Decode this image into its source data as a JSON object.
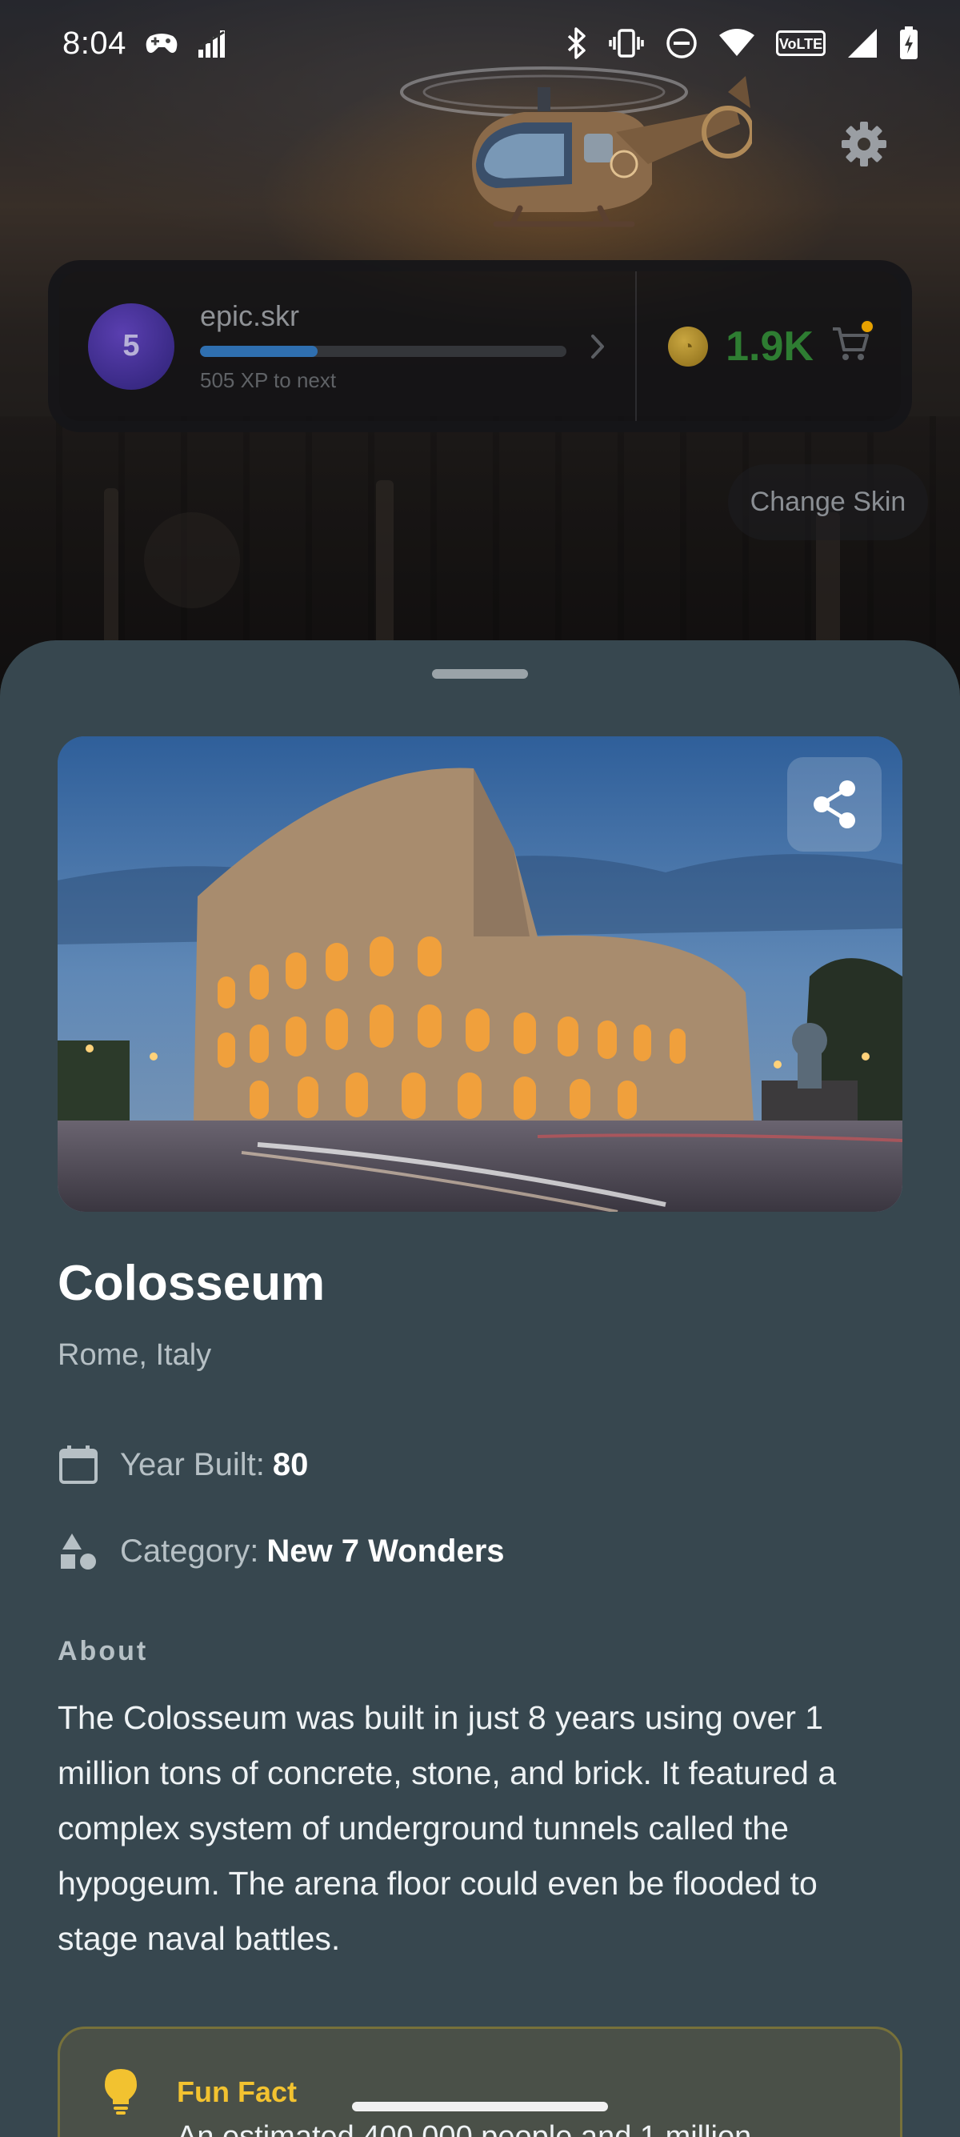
{
  "status_bar": {
    "time": "8:04"
  },
  "profile": {
    "level": "5",
    "username": "epic.skr",
    "xp_progress_percent": 32,
    "xp_to_next": "505 XP to next",
    "coins": "1.9K"
  },
  "change_skin_label": "Change Skin",
  "landmark": {
    "title": "Colosseum",
    "location": "Rome, Italy",
    "year_label": "Year Built:",
    "year_value": "80",
    "category_label": "Category:",
    "category_value": "New 7 Wonders",
    "about_heading": "About",
    "about_text": "The Colosseum was built in just 8 years using over 1 million tons of concrete, stone, and brick. It featured a complex system of underground tunnels called the hypogeum. The arena floor could even be flooded to stage naval battles.",
    "fun_fact_title": "Fun Fact",
    "fun_fact_text": "An estimated 400,000 people and 1 million"
  },
  "colors": {
    "sheet_bg": "#37474f",
    "coin_green": "#2e7d32",
    "fun_fact_yellow": "#f2c230",
    "xp_blue": "#2f6fb0"
  }
}
